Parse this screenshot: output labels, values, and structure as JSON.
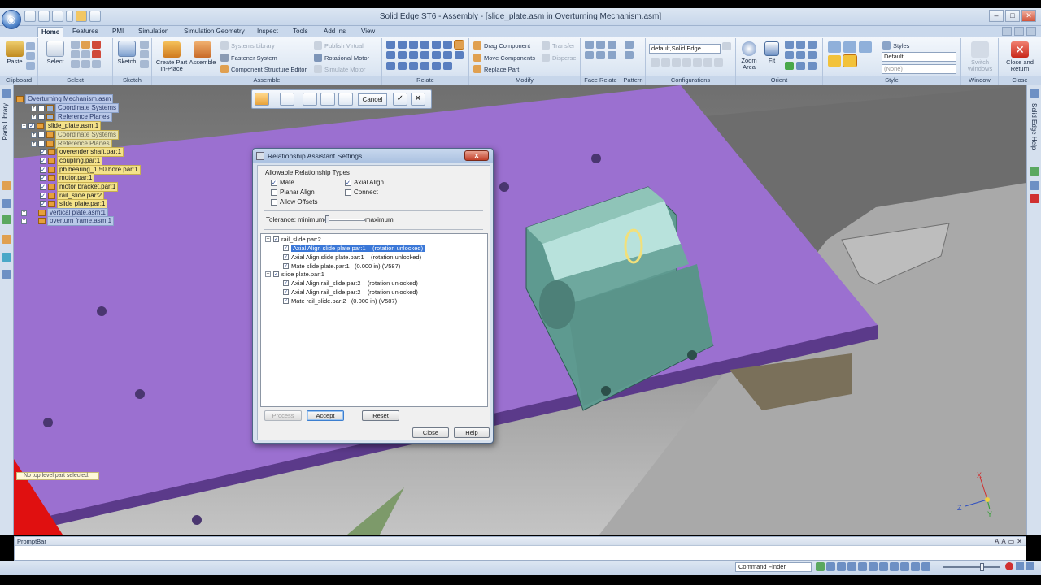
{
  "window": {
    "title": "Solid Edge ST6 - Assembly - [slide_plate.asm in Overturning Mechanism.asm]"
  },
  "tabs": [
    "Home",
    "Features",
    "PMI",
    "Simulation",
    "Simulation Geometry",
    "Inspect",
    "Tools",
    "Add Ins",
    "View"
  ],
  "ribbon": {
    "clipboard": {
      "paste": "Paste",
      "label": "Clipboard"
    },
    "select": {
      "select": "Select",
      "label": "Select"
    },
    "sketch": {
      "sketch": "Sketch",
      "label": "Sketch"
    },
    "assemble": {
      "create_part": "Create Part",
      "in_place": "In-Place",
      "assemble": "Assemble",
      "systems_library": "Systems Library",
      "fastener_system": "Fastener System",
      "component_structure_editor": "Component Structure Editor",
      "publish_virtual": "Publish Virtual",
      "rotational_motor": "Rotational Motor",
      "simulate_motor": "Simulate Motor",
      "label": "Assemble"
    },
    "relate": {
      "label": "Relate"
    },
    "modify": {
      "drag_component": "Drag Component",
      "move_components": "Move Components",
      "replace_part": "Replace Part",
      "transfer": "Transfer",
      "disperse": "Disperse",
      "label": "Modify"
    },
    "face_relate": {
      "label": "Face Relate"
    },
    "pattern": {
      "label": "Pattern"
    },
    "configurations": {
      "combo": "default,Solid Edge",
      "label": "Configurations"
    },
    "orient": {
      "zoom": "Zoom",
      "area": "Area",
      "fit": "Fit",
      "label": "Orient"
    },
    "style": {
      "styles": "Styles",
      "default": "Default",
      "none": "(None)",
      "label": "Style"
    },
    "window": {
      "switch": "Switch",
      "windows": "Windows",
      "label": "Window"
    },
    "close": {
      "close_and": "Close and",
      "return": "Return",
      "label": "Close"
    }
  },
  "left_strip": {
    "label": "Parts Library"
  },
  "right_strip": {
    "label": "Solid Edge Help"
  },
  "tree": {
    "root": "Overturning Mechanism.asm",
    "items": [
      {
        "label": "Coordinate Systems"
      },
      {
        "label": "Reference Planes"
      },
      {
        "label": "slide_plate.asm:1"
      },
      {
        "label": "Coordinate Systems"
      },
      {
        "label": "Reference Planes"
      },
      {
        "label": "overender shaft.par:1"
      },
      {
        "label": "coupling.par:1"
      },
      {
        "label": "pb bearing_1.50 bore.par:1"
      },
      {
        "label": "motor.par:1"
      },
      {
        "label": "motor bracket.par:1"
      },
      {
        "label": "rail_slide.par:2"
      },
      {
        "label": "slide plate.par:1"
      },
      {
        "label": "vertical plate.asm:1"
      },
      {
        "label": "overturn frame.asm:1"
      }
    ]
  },
  "status_tip": "No top level part selected.",
  "command_bar": {
    "cancel": "Cancel"
  },
  "dialog": {
    "title": "Relationship Assistant Settings",
    "close": "x",
    "group_title": "Allowable Relationship Types",
    "mate": "Mate",
    "planar_align": "Planar Align",
    "allow_offsets": "Allow Offsets",
    "axial_align": "Axial Align",
    "connect": "Connect",
    "tolerance": "Tolerance:  minimum",
    "maximum": "maximum",
    "list": {
      "group1": "rail_slide.par:2",
      "g1_items": [
        {
          "name": "Axial Align slide plate.par:1",
          "detail": "(rotation unlocked)"
        },
        {
          "name": "Axial Align slide plate.par:1",
          "detail": "(rotation unlocked)"
        },
        {
          "name": "Mate slide plate.par:1",
          "detail": "(0.000 in)   (V587)"
        }
      ],
      "group2": "slide plate.par:1",
      "g2_items": [
        {
          "name": "Axial Align rail_slide.par:2",
          "detail": "(rotation unlocked)"
        },
        {
          "name": "Axial Align rail_slide.par:2",
          "detail": "(rotation unlocked)"
        },
        {
          "name": "Mate rail_slide.par:2",
          "detail": "(0.000 in)   (V587)"
        }
      ]
    },
    "process": "Process",
    "accept": "Accept",
    "reset": "Reset",
    "close_btn": "Close",
    "help": "Help"
  },
  "prompt_bar": {
    "title": "PromptBar"
  },
  "status": {
    "command_finder": "Command Finder"
  },
  "triad": {
    "x": "X",
    "y": "Y",
    "z": "Z"
  },
  "colors": {
    "plate": "#9b70d0",
    "part": "#5e9a90",
    "ribbon": "#dde7f3"
  }
}
